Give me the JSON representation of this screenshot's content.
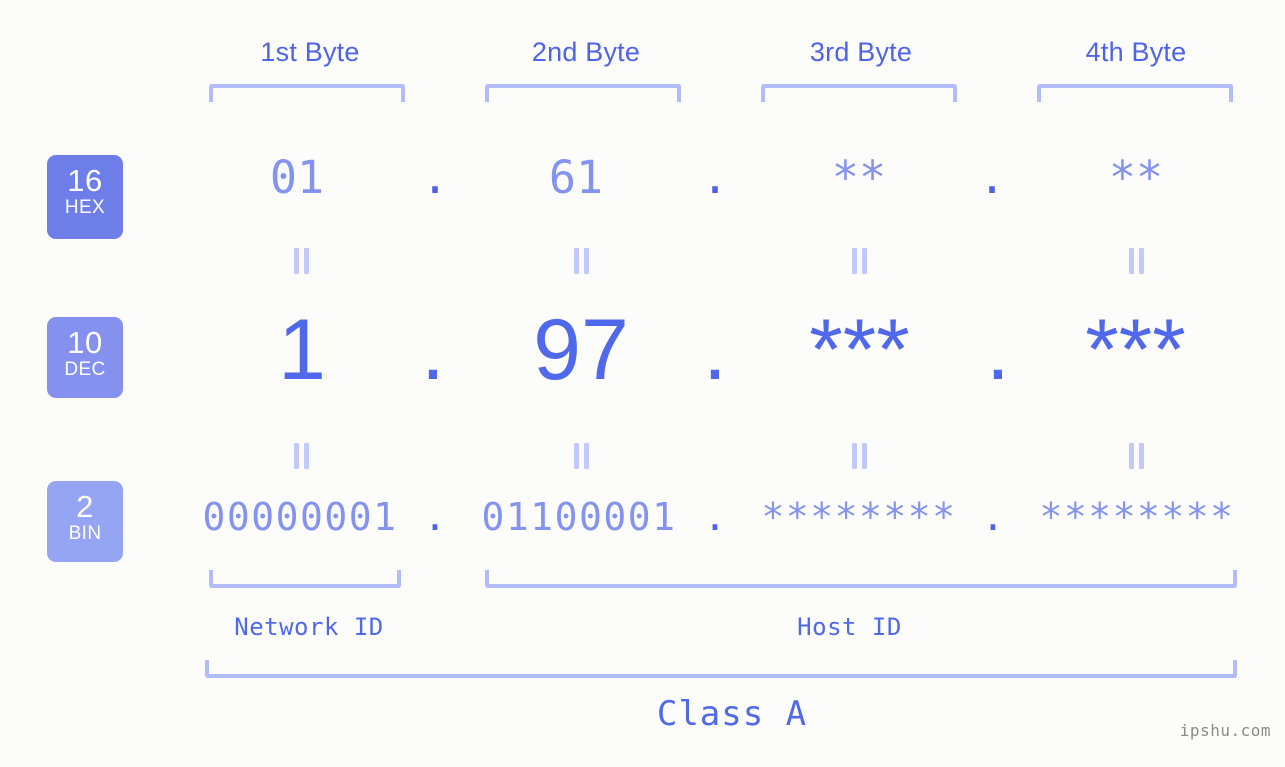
{
  "meta": {
    "background_color": "#fcfdfa",
    "accent_color": "#5068ea",
    "light_accent_color": "#b3bcfb",
    "value_color": "#8492f0",
    "watermark": "ipshu.com"
  },
  "byte_headers": [
    {
      "label": "1st Byte"
    },
    {
      "label": "2nd Byte"
    },
    {
      "label": "3rd Byte"
    },
    {
      "label": "4th Byte"
    }
  ],
  "bases": [
    {
      "id": "hex",
      "number": "16",
      "name": "HEX",
      "color": "#6d7ee9"
    },
    {
      "id": "dec",
      "number": "10",
      "name": "DEC",
      "color": "#8491ee"
    },
    {
      "id": "bin",
      "number": "2",
      "name": "BIN",
      "color": "#96a4f4"
    }
  ],
  "rows": {
    "hex": {
      "octets": [
        "01",
        "61",
        "**",
        "**"
      ],
      "separator": "."
    },
    "dec": {
      "octets": [
        "1",
        "97",
        "***",
        "***"
      ],
      "separator": "."
    },
    "bin": {
      "octets": [
        "00000001",
        "01100001",
        "********",
        "********"
      ],
      "separator": "."
    }
  },
  "equals_symbol": "=",
  "id_labels": [
    {
      "label": "Network ID"
    },
    {
      "label": "Host ID"
    }
  ],
  "class_label": "Class A"
}
